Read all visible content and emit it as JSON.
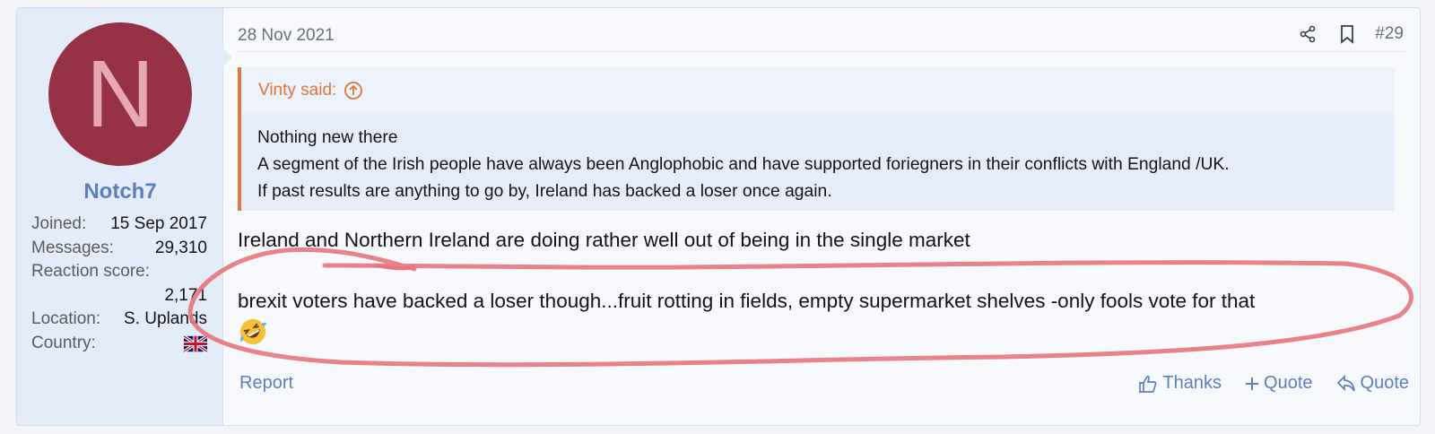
{
  "user": {
    "avatar_letter": "N",
    "avatar_color": "#973145",
    "name": "Notch7",
    "stats": [
      {
        "label": "Joined:",
        "value": "15 Sep 2017"
      },
      {
        "label": "Messages:",
        "value": "29,310"
      },
      {
        "label": "Reaction score:",
        "value": "2,171"
      },
      {
        "label": "Location:",
        "value": "S. Uplands"
      },
      {
        "label": "Country:",
        "value_icon": "uk-flag-icon"
      }
    ]
  },
  "post": {
    "date": "28 Nov 2021",
    "number": "#29",
    "share_icon": "share-icon",
    "bookmark_icon": "bookmark-icon",
    "quote": {
      "author_line": "Vinty said:",
      "lines": [
        "Nothing new there",
        "A segment of the Irish people have always been Anglophobic and have supported foriegners in their conflicts with England /UK.",
        "If past results are anything to go by, Ireland has backed a loser once again."
      ]
    },
    "message": {
      "line1": "Ireland and Northern Ireland are doing rather well out of being in the single market",
      "line2": "brexit voters have backed a loser though...fruit rotting in fields, empty supermarket shelves -only fools vote for that",
      "emoji_icon": "rofl-emoji-icon"
    },
    "footer": {
      "report": "Report",
      "thanks": "Thanks",
      "multi_quote": "Quote",
      "quote": "Quote"
    }
  },
  "colors": {
    "accent": "#5d7fbf",
    "quote_author": "#dd7638",
    "annotation": "#e8747c"
  }
}
